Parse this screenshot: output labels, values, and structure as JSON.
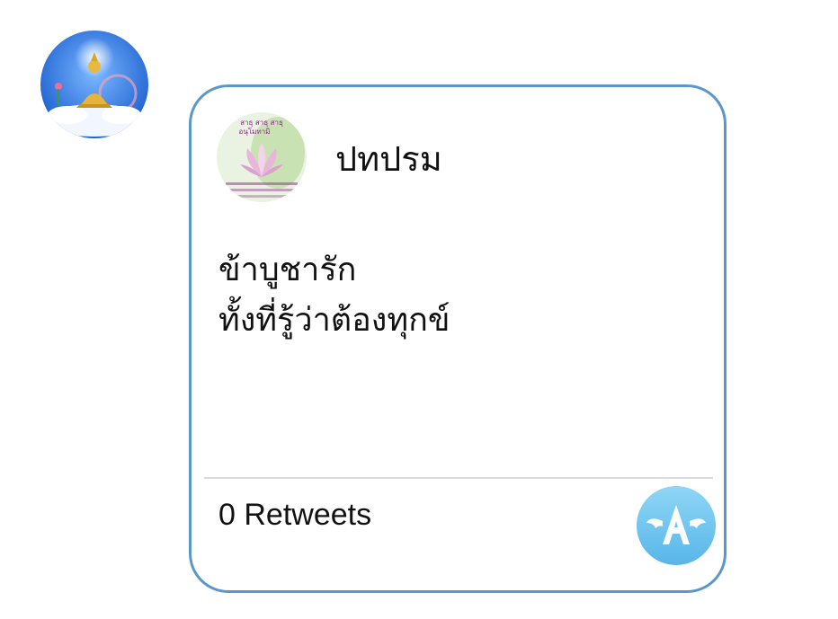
{
  "message": {
    "card": {
      "author_name": "ปทปรม",
      "author_avatar_text": {
        "line1": "สาธุ สาธุ สาธุ",
        "line2": "อนุโมทามิ"
      },
      "text_lines": [
        "ข้าบูชารัก",
        "ทั้งที่รู้ว่าต้องทุกข์"
      ],
      "retweets_label": "0 Retweets"
    }
  },
  "icons": {
    "sender_avatar": "buddha-avatar-icon",
    "app_badge": "winged-a-app-icon"
  },
  "colors": {
    "card_border": "#5b97c9",
    "divider": "#dcdcdc",
    "badge_blue": "#6cc2ee"
  }
}
